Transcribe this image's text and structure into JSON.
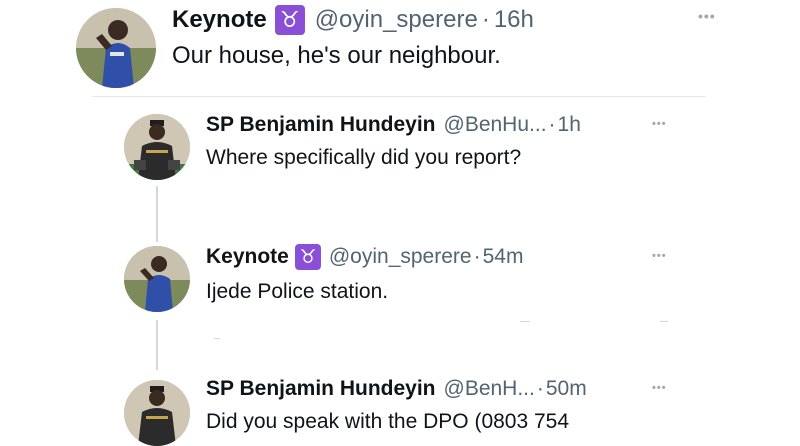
{
  "main_tweet": {
    "name": "Keynote",
    "badge": "♉",
    "handle": "@oyin_sperere",
    "separator": "·",
    "time": "16h",
    "text": "Our house, he's our neighbour.",
    "more_icon": "more-horizontal-icon"
  },
  "replies": [
    {
      "name": "SP Benjamin Hundeyin",
      "handle": "@BenHu...",
      "separator": "·",
      "time": "1h",
      "text": "Where specifically did you report?"
    },
    {
      "name": "Keynote",
      "badge": "♉",
      "handle": "@oyin_sperere",
      "separator": "·",
      "time": "54m",
      "text": "Ijede Police station."
    },
    {
      "name": "SP Benjamin Hundeyin",
      "handle": "@BenH...",
      "separator": "·",
      "time": "50m",
      "text": "Did you speak with the DPO (0803 754"
    }
  ],
  "more_label": "•••",
  "colors": {
    "text_primary": "#0f1419",
    "text_secondary": "#536471",
    "badge_bg": "#8a4fd6",
    "divider": "#e6e9ec",
    "thread_line": "#cfd9de"
  }
}
